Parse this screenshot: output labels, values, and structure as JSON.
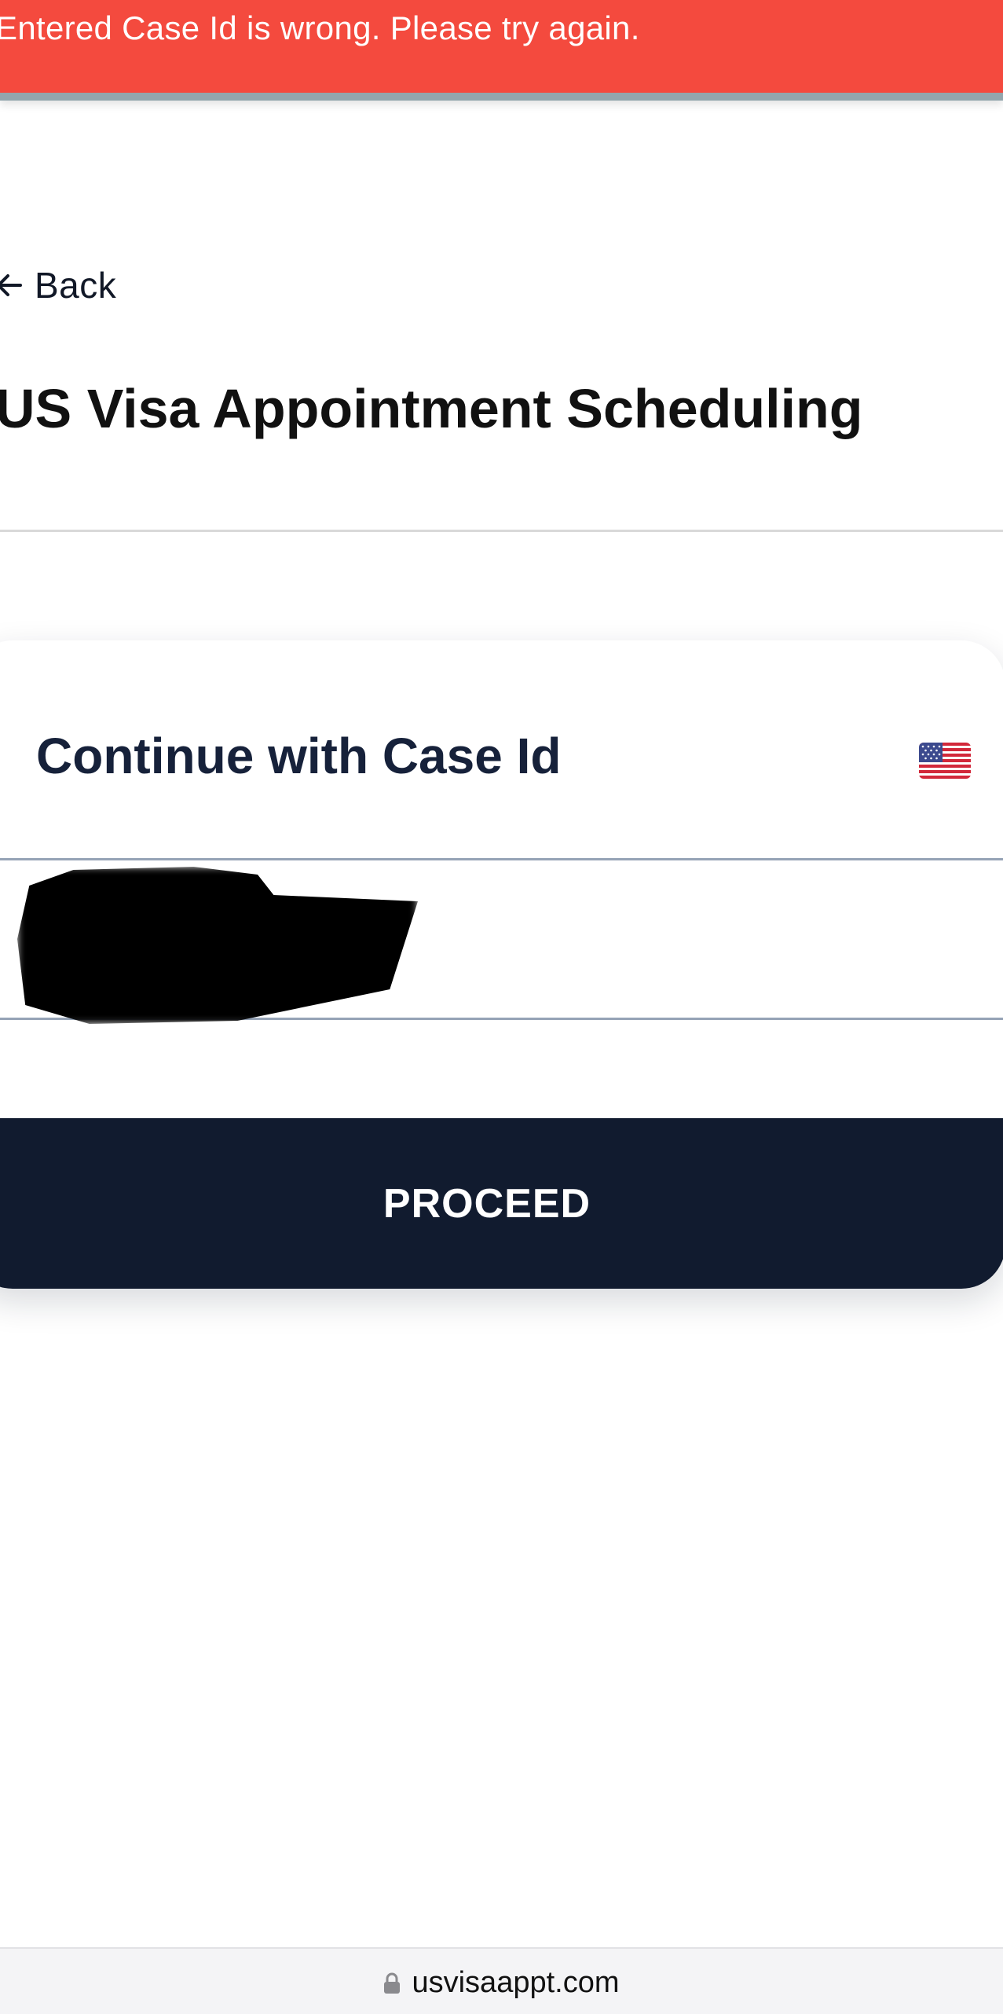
{
  "banner": {
    "message": "Entered Case Id is wrong. Please try again."
  },
  "nav": {
    "back_label": "Back"
  },
  "page": {
    "title": "US Visa Appointment Scheduling"
  },
  "card": {
    "title": "Continue with Case Id",
    "flag_icon": "us-flag-icon",
    "case_input": {
      "value": "",
      "placeholder": ""
    },
    "proceed_label": "PROCEED"
  },
  "browser": {
    "url": "usvisaappt.com",
    "lock_icon": "lock-icon"
  },
  "colors": {
    "error": "#f44a3e",
    "primary": "#111b2f",
    "text": "#16213a"
  }
}
